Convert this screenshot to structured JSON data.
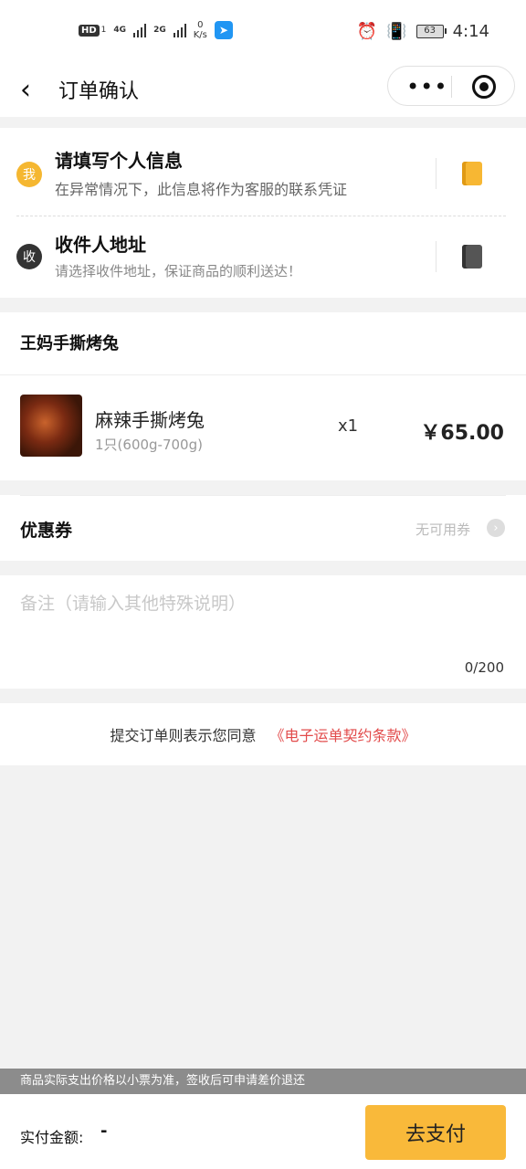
{
  "status_bar": {
    "hd_label": "HD",
    "hd_sub": "1",
    "net1": "4G",
    "net2": "2G",
    "speed_value": "0",
    "speed_unit": "K/s",
    "battery": "63",
    "time": "4:14"
  },
  "nav": {
    "title": "订单确认",
    "menu_label": "•••"
  },
  "personal_info": {
    "badge": "我",
    "title": "请填写个人信息",
    "subtitle": "在异常情况下，此信息将作为客服的联系凭证",
    "badge_color": "#f5b731"
  },
  "address": {
    "badge": "收",
    "title": "收件人地址",
    "subtitle": "请选择收件地址，保证商品的顺利送达！",
    "badge_color": "#333333"
  },
  "shop": {
    "name": "王妈手撕烤兔"
  },
  "product": {
    "name": "麻辣手撕烤兔",
    "spec": "1只(600g-700g)",
    "quantity": "x1",
    "price": "￥65.00"
  },
  "coupon": {
    "label": "优惠券",
    "value": "无可用券",
    "chevron": "›"
  },
  "remark": {
    "placeholder": "备注（请输入其他特殊说明）",
    "counter": "0/200"
  },
  "agreement": {
    "text": "提交订单则表示您同意",
    "link": "《电子运单契约条款》",
    "link_color": "#e24b4b"
  },
  "notice": "商品实际支出价格以小票为准，签收后可申请差价退还",
  "footer": {
    "amount_label": "实付金额:",
    "amount_value": "-",
    "pay_button": "去支付",
    "button_color": "#f9b93a"
  }
}
